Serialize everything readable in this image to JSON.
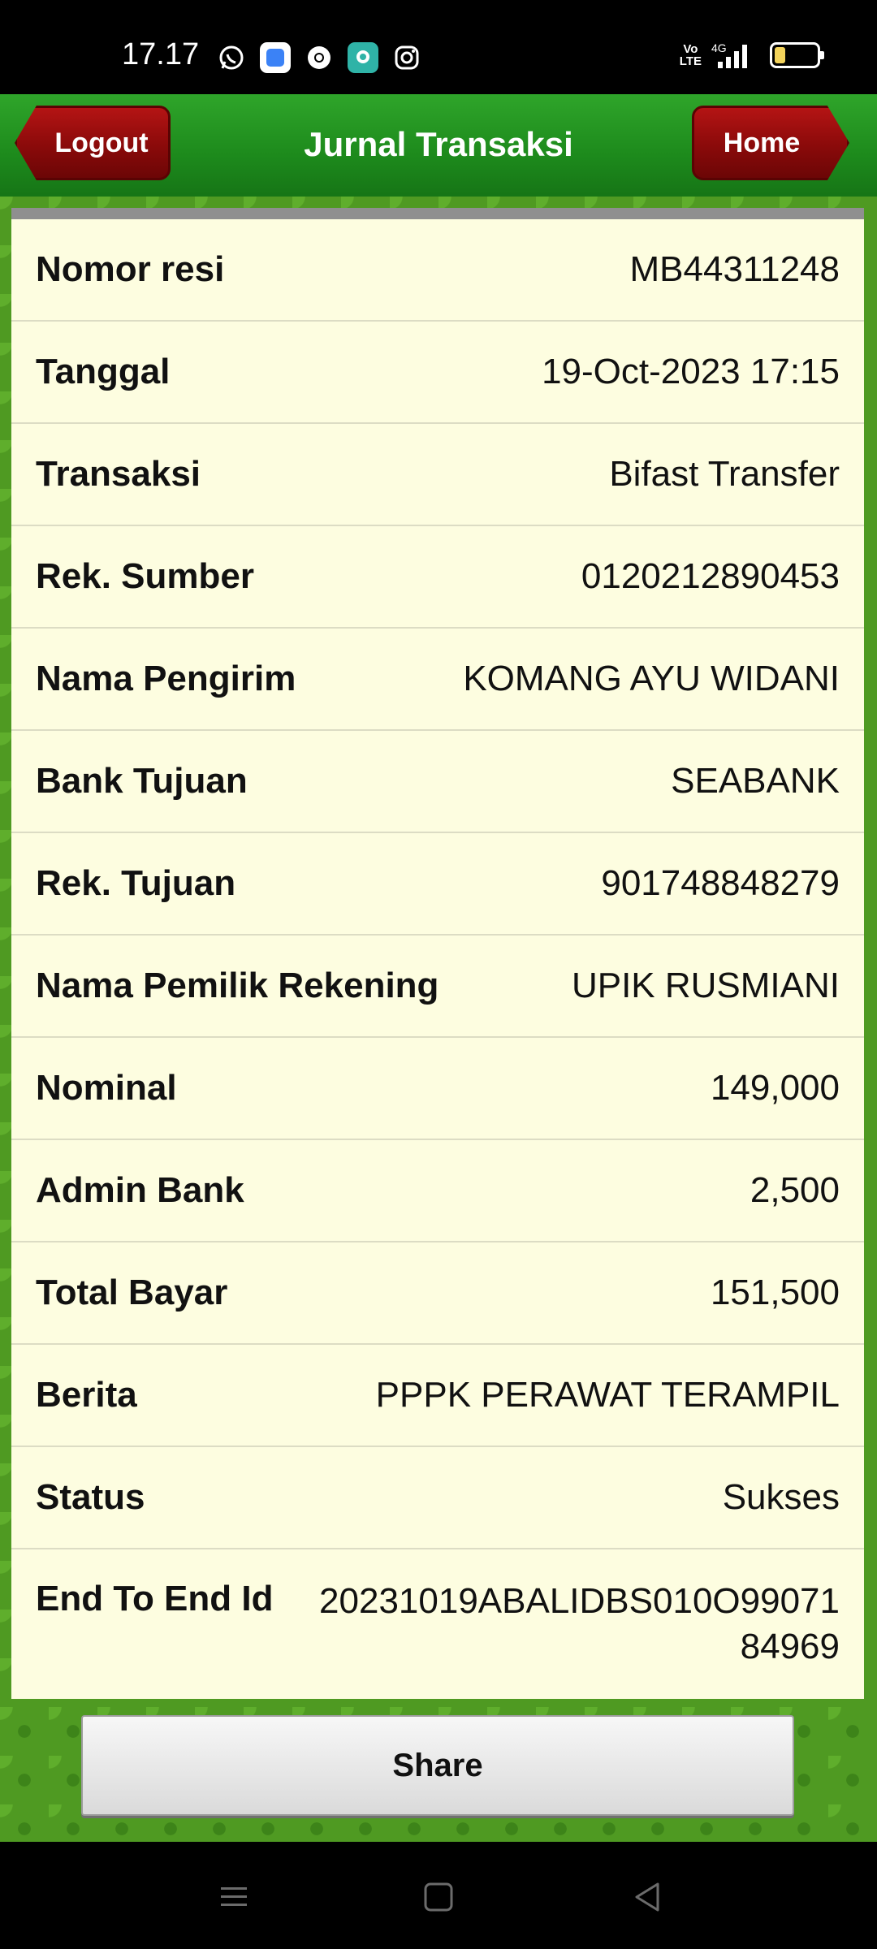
{
  "status_bar": {
    "time": "17.17",
    "volte": "Vo\nLTE",
    "network": "4G",
    "app_icons": [
      "whatsapp-icon",
      "app-blue-icon",
      "chrome-icon",
      "app-teal-icon",
      "instagram-icon"
    ]
  },
  "header": {
    "title": "Jurnal Transaksi",
    "logout_label": "Logout",
    "home_label": "Home"
  },
  "details": [
    {
      "label": "Nomor resi",
      "value": "MB44311248"
    },
    {
      "label": "Tanggal",
      "value": "19-Oct-2023 17:15"
    },
    {
      "label": "Transaksi",
      "value": "Bifast Transfer"
    },
    {
      "label": "Rek. Sumber",
      "value": "0120212890453"
    },
    {
      "label": "Nama Pengirim",
      "value": "KOMANG AYU WIDANI"
    },
    {
      "label": "Bank Tujuan",
      "value": "SEABANK"
    },
    {
      "label": "Rek. Tujuan",
      "value": "901748848279"
    },
    {
      "label": "Nama Pemilik Rekening",
      "value": "UPIK RUSMIANI"
    },
    {
      "label": "Nominal",
      "value": "149,000"
    },
    {
      "label": "Admin Bank",
      "value": "2,500"
    },
    {
      "label": "Total Bayar",
      "value": "151,500"
    },
    {
      "label": "Berita",
      "value": "PPPK PERAWAT TERAMPIL"
    },
    {
      "label": "Status",
      "value": "Sukses"
    },
    {
      "label": "End To End Id",
      "value": "20231019ABALIDBS010O9907184969"
    }
  ],
  "share_label": "Share",
  "colors": {
    "header_green": "#1d8a1c",
    "button_red": "#8a0a0a",
    "card_bg": "#fdfde0",
    "pattern_green": "#4f9a22"
  }
}
